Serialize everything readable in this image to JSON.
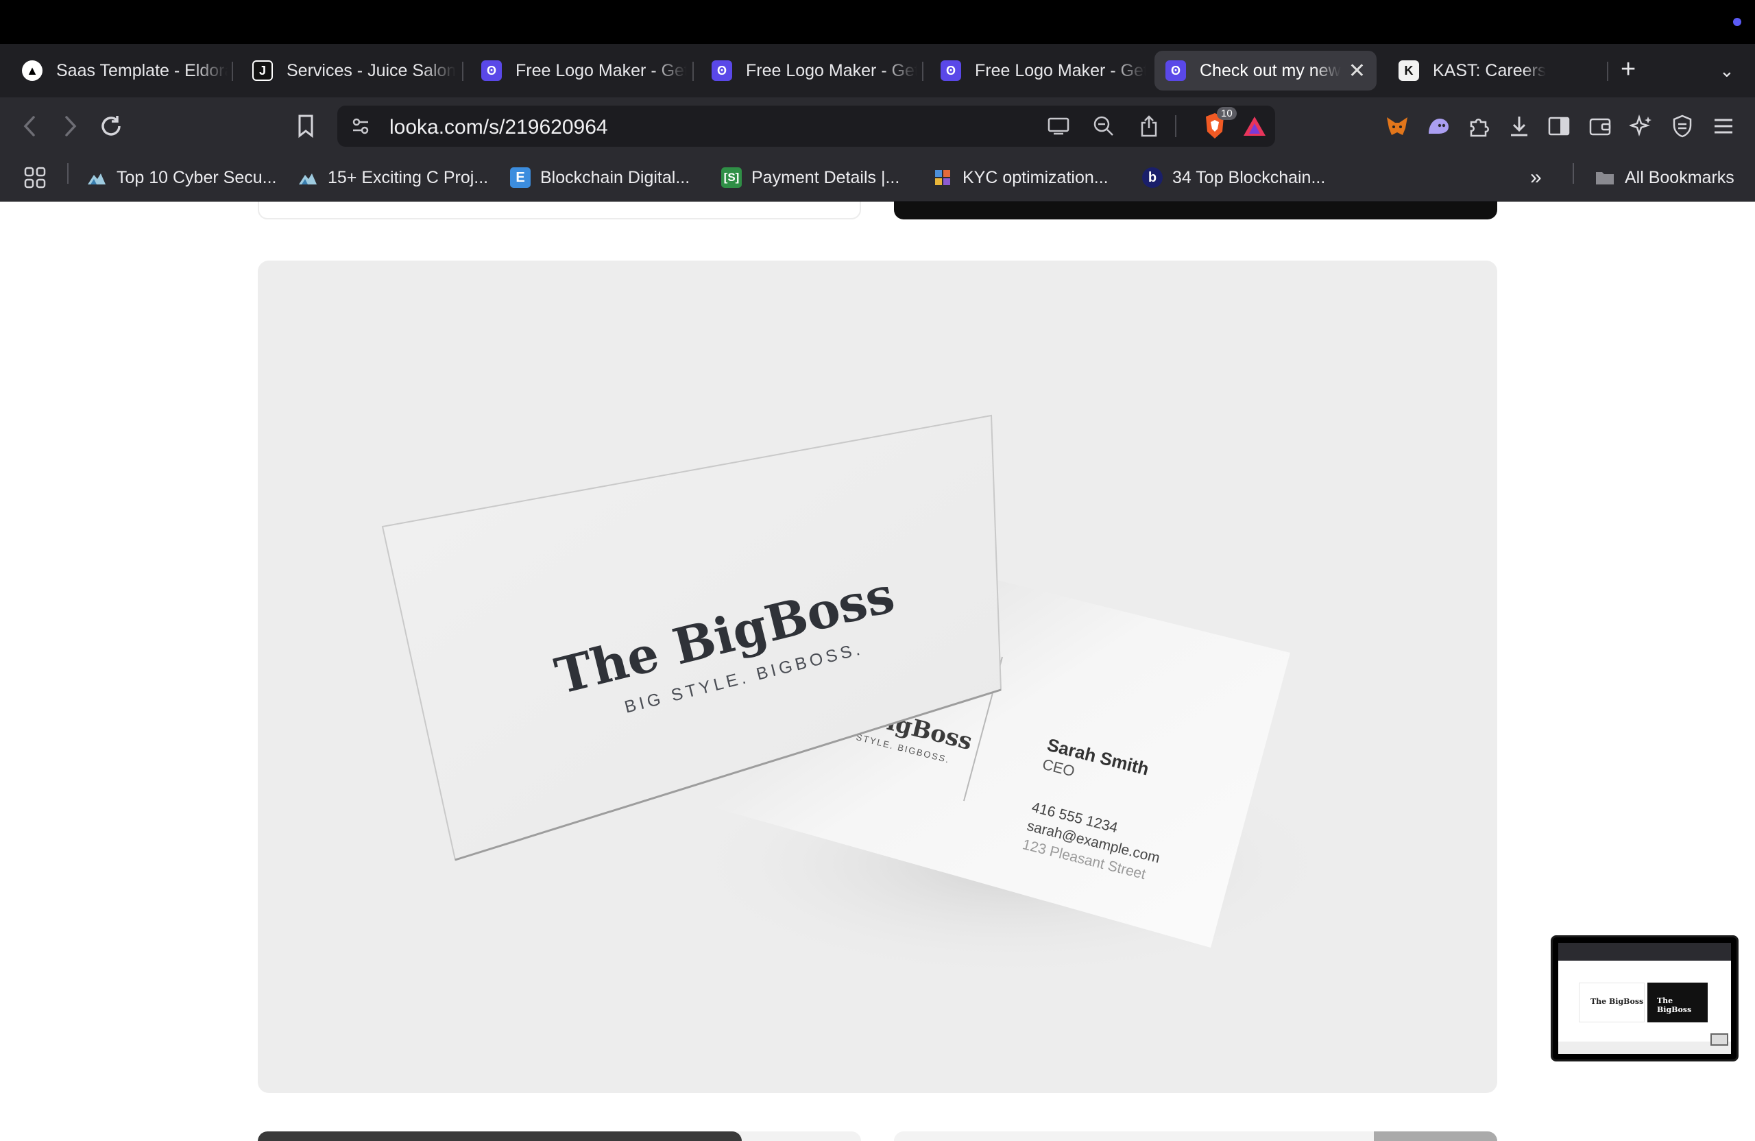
{
  "browser": {
    "tabs": [
      {
        "label": "Saas Template - Eldora",
        "icon": "eldora-triangle-icon",
        "active": false
      },
      {
        "label": "Services - Juice Salon",
        "icon": "juice-logo-icon",
        "active": false
      },
      {
        "label": "Free Logo Maker - Get",
        "icon": "looka-icon",
        "active": false
      },
      {
        "label": "Free Logo Maker - Get",
        "icon": "looka-icon",
        "active": false
      },
      {
        "label": "Free Logo Maker - Get",
        "icon": "looka-icon",
        "active": false
      },
      {
        "label": "Check out my new",
        "icon": "looka-icon",
        "active": true
      },
      {
        "label": "KAST: Careers",
        "icon": "kast-icon",
        "active": false
      }
    ],
    "url": "looka.com/s/219620964",
    "shields_count": "10",
    "bookmarks": [
      {
        "label": "Top 10 Cyber Secu...",
        "icon": "mountain-icon"
      },
      {
        "label": "15+ Exciting C Proj...",
        "icon": "mountain-icon"
      },
      {
        "label": "Blockchain Digital...",
        "icon": "e-icon"
      },
      {
        "label": "Payment Details |...",
        "icon": "s-bracket-icon"
      },
      {
        "label": "KYC optimization...",
        "icon": "kyc-icon"
      },
      {
        "label": "34 Top Blockchain...",
        "icon": "b-circle-icon"
      }
    ],
    "all_bookmarks_label": "All Bookmarks"
  },
  "mockup": {
    "brand_name": "The BigBoss",
    "tagline": "BIG STYLE. BIGBOSS.",
    "back_brand_partial": "BigBoss",
    "back_tagline_partial": "STYLE. BIGBOSS.",
    "contact_name": "Sarah Smith",
    "contact_title": "CEO",
    "phone": "416 555 1234",
    "email": "sarah@example.com",
    "address": "123 Pleasant Street"
  },
  "pip": {
    "left_card_text": "The BigBoss",
    "right_card_text": "The BigBoss"
  },
  "colors": {
    "accent": "#5a48e8",
    "mockup_bg": "#ededed",
    "card_dark": "#0f0f0f"
  }
}
